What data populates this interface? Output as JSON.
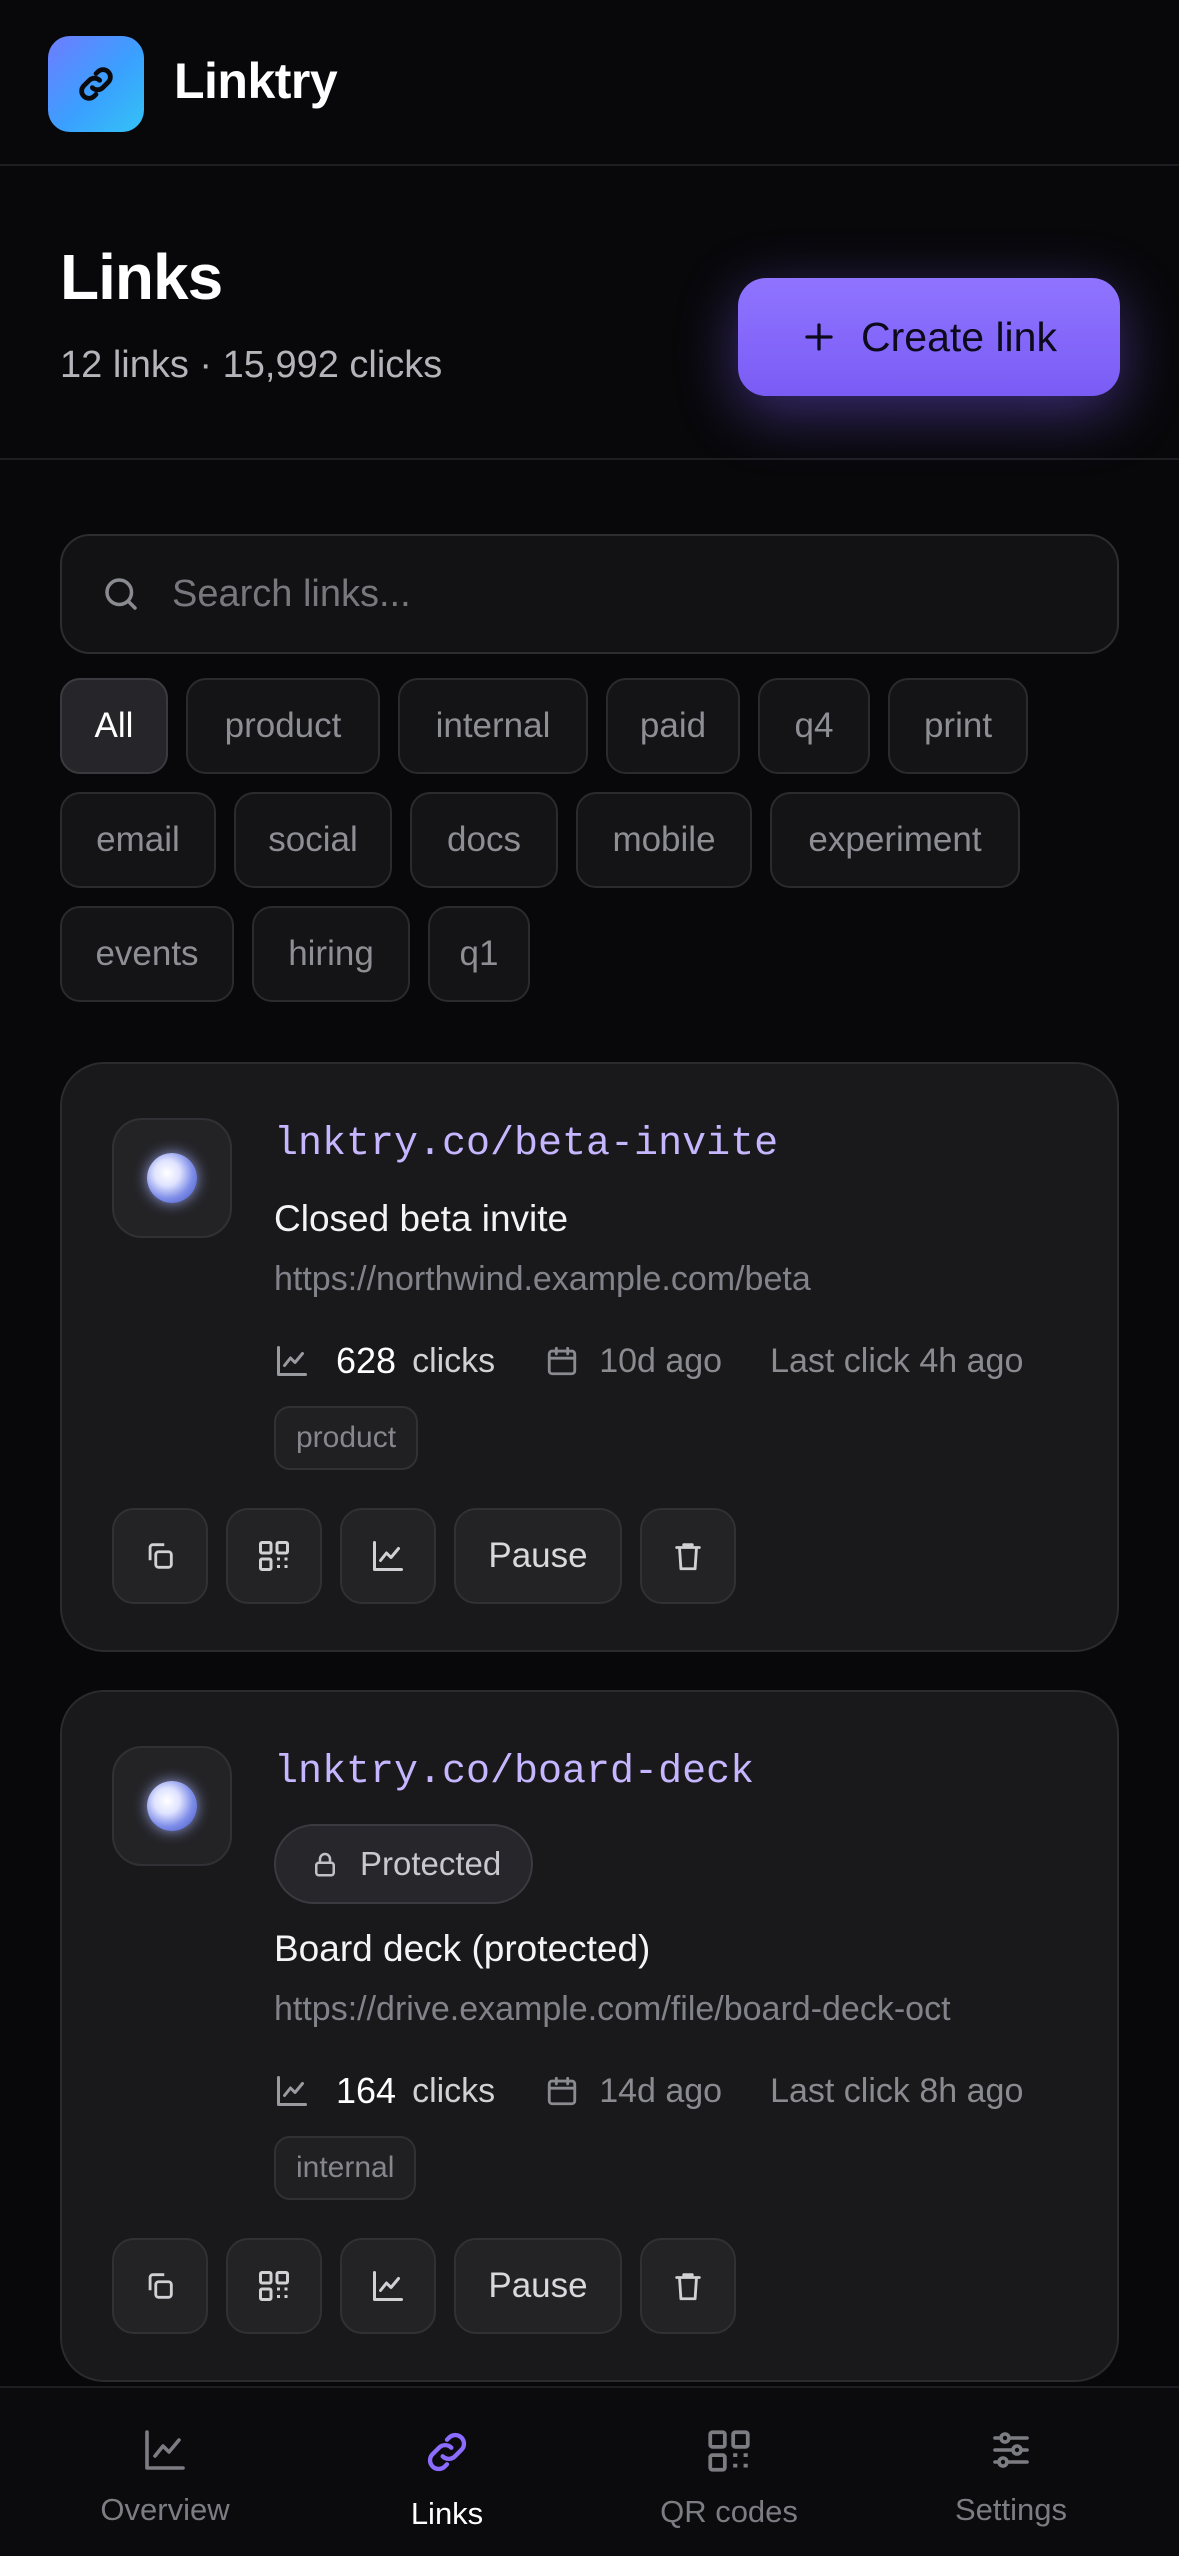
{
  "app": {
    "name": "Linktry"
  },
  "page": {
    "title": "Links",
    "subtitle": "12 links · 15,992 clicks",
    "create_label": "Create link"
  },
  "search": {
    "placeholder": "Search links..."
  },
  "filters": [
    "All",
    "product",
    "internal",
    "paid",
    "q4",
    "print",
    "email",
    "social",
    "docs",
    "mobile",
    "experiment",
    "events",
    "hiring",
    "q1"
  ],
  "active_filter": "All",
  "links": [
    {
      "short": "lnktry.co/beta-invite",
      "title": "Closed beta invite",
      "destination": "https://northwind.example.com/beta",
      "clicks": "628",
      "clicks_label": "clicks",
      "created": "10d ago",
      "last_click": "Last click 4h ago",
      "tag": "product",
      "pause_label": "Pause"
    },
    {
      "short": "lnktry.co/board-deck",
      "badge": "Protected",
      "title": "Board deck (protected)",
      "destination": "https://drive.example.com/file/board-deck-oct",
      "clicks": "164",
      "clicks_label": "clicks",
      "created": "14d ago",
      "last_click": "Last click 8h ago",
      "tag": "internal",
      "pause_label": "Pause"
    }
  ],
  "nav": [
    {
      "label": "Overview",
      "icon": "chart-icon"
    },
    {
      "label": "Links",
      "icon": "link-icon",
      "active": true
    },
    {
      "label": "QR codes",
      "icon": "qr-icon"
    },
    {
      "label": "Settings",
      "icon": "sliders-icon"
    }
  ],
  "colors": {
    "accent": "#7a5cf5",
    "short_link": "#c6b6ff",
    "background": "#08080a"
  }
}
